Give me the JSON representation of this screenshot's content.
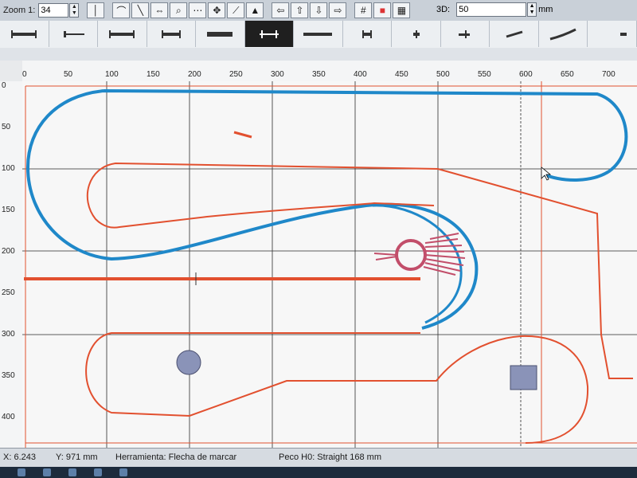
{
  "toolbar": {
    "zoom_label": "Zoom 1:",
    "zoom_value": "34",
    "height_label": "3D:",
    "height_value": "50",
    "height_unit": "mm"
  },
  "ruler": {
    "x_ticks": [
      "0",
      "50",
      "100",
      "150",
      "200",
      "250",
      "300",
      "350",
      "400",
      "450",
      "500",
      "550",
      "600",
      "650",
      "700"
    ],
    "y_ticks": [
      "0",
      "50",
      "100",
      "150",
      "200",
      "250",
      "300",
      "350",
      "400"
    ]
  },
  "status": {
    "x": "X: 6.243",
    "y": "Y: 971 mm",
    "tool": "Herramienta: Flecha de marcar",
    "piece": "Peco H0: Straight 168 mm"
  },
  "colors": {
    "track_red": "#e2502f",
    "track_blue": "#1f88c9",
    "turntable": "#c24e6a",
    "grid": "#2b2b2b",
    "object_fill": "#8a93b8"
  },
  "icons": {
    "toolbar": [
      "track-tool-icon",
      "curve-tool-icon",
      "line-tool-icon",
      "flip-icon",
      "zoom-icon",
      "move-icon",
      "select-icon",
      "measure-icon",
      "terrain-icon",
      "prev-icon",
      "up-icon",
      "down-icon",
      "next-icon",
      "grid-icon",
      "color-icon",
      "layer-icon"
    ],
    "tracks": [
      "straight-icon",
      "buffer-icon",
      "long-straight-icon",
      "short-icon",
      "uncoupler-icon",
      "crossing-icon",
      "long-icon",
      "small-icon",
      "end-icon",
      "left-turnout-icon",
      "right-turnout-icon",
      "flex-icon",
      "more-icon"
    ]
  }
}
